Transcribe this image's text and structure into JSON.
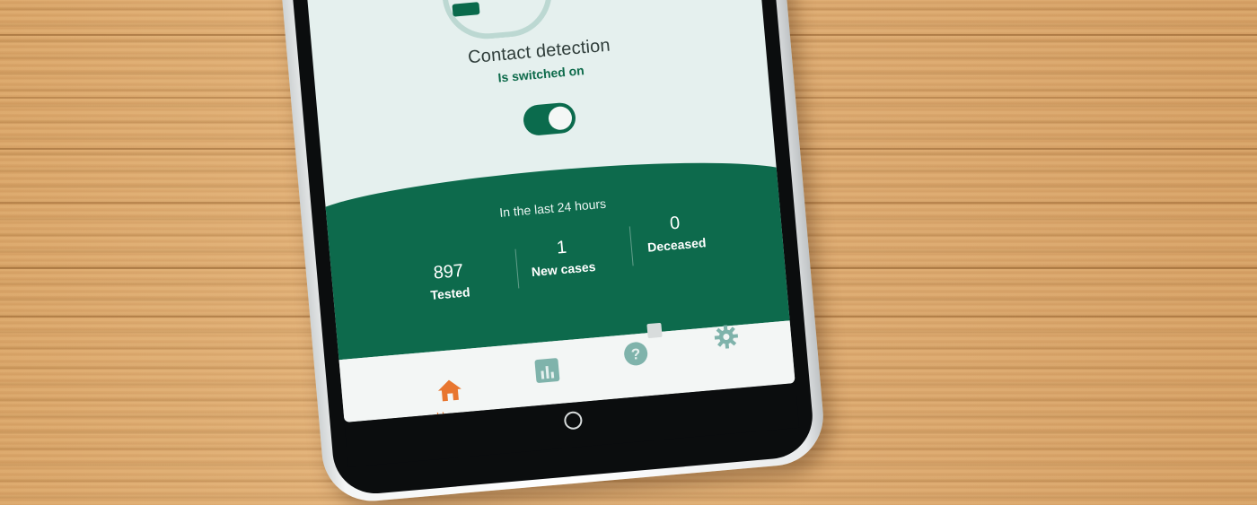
{
  "screen": {
    "title": "Contact detection",
    "status": "Is switched on",
    "toggle_on": true
  },
  "stats": {
    "heading": "In the last 24 hours",
    "items": [
      {
        "value": "897",
        "label": "Tested"
      },
      {
        "value": "1",
        "label": "New cases"
      },
      {
        "value": "0",
        "label": "Deceased"
      }
    ]
  },
  "nav": {
    "home_label": "Home",
    "icons": [
      "home-icon",
      "chart-icon",
      "help-icon",
      "gear-icon"
    ]
  },
  "colors": {
    "brand_green": "#0d6a4c",
    "accent_orange": "#e8762f",
    "screen_bg": "#e5f0ee",
    "wood": "#dcaa71"
  }
}
